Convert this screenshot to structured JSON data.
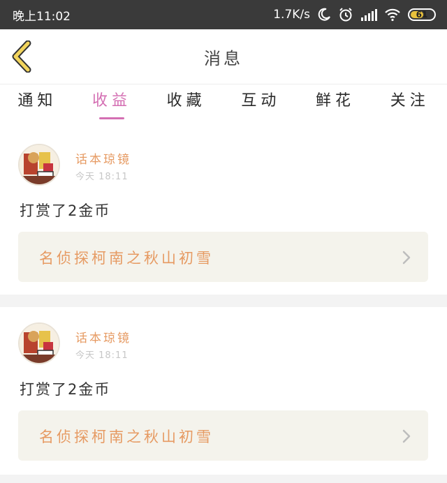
{
  "status_bar": {
    "time": "晚上11:02",
    "network_speed": "1.7K/s",
    "battery": "61",
    "battery_level_percent": 61,
    "icons": [
      "moon-icon",
      "alarm-icon",
      "signal-icon",
      "wifi-icon",
      "battery-icon"
    ]
  },
  "header": {
    "title": "消息",
    "back_icon": "chevron-left-icon"
  },
  "tabs": [
    {
      "label": "通知",
      "active": false
    },
    {
      "label": "收益",
      "active": true
    },
    {
      "label": "收藏",
      "active": false
    },
    {
      "label": "互动",
      "active": false
    },
    {
      "label": "鲜花",
      "active": false
    },
    {
      "label": "关注",
      "active": false
    }
  ],
  "messages": [
    {
      "sender": "话本琼镜",
      "time": "今天 18:11",
      "content": "打赏了2金币",
      "book_title": "名侦探柯南之秋山初雪"
    },
    {
      "sender": "话本琼镜",
      "time": "今天 18:11",
      "content": "打赏了2金币",
      "book_title": "名侦探柯南之秋山初雪"
    }
  ],
  "colors": {
    "status_bar_bg": "#3a3a3a",
    "accent_pink": "#d46fb3",
    "accent_orange": "#e69a62",
    "card_link_bg": "#f4f3ec",
    "back_arrow_fill": "#f2d45c",
    "battery_fill": "#e9c23c"
  }
}
